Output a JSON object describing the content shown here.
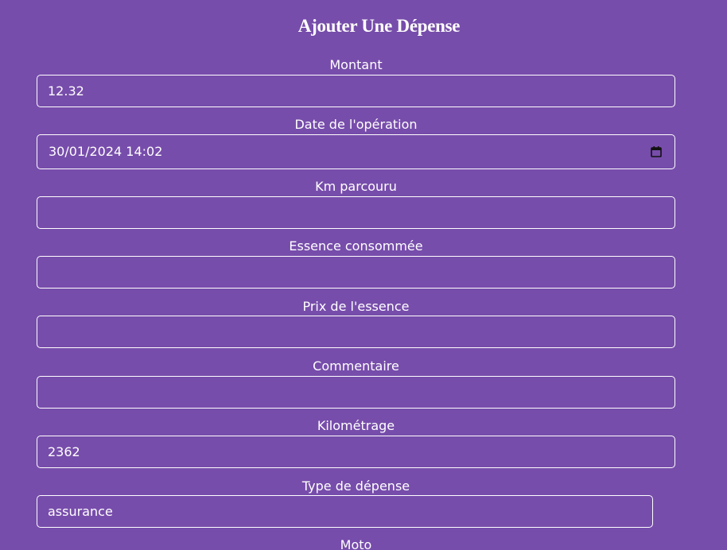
{
  "title": "Ajouter Une Dépense",
  "fields": [
    {
      "label": "Montant",
      "value": "12.32"
    },
    {
      "label": "Date de l'opération",
      "value": "30/01/2024 14:02",
      "icon": "calendar-icon"
    },
    {
      "label": "Km parcouru",
      "value": ""
    },
    {
      "label": "Essence consommée",
      "value": ""
    },
    {
      "label": "Prix de l'essence",
      "value": ""
    },
    {
      "label": "Commentaire",
      "value": ""
    },
    {
      "label": "Kilométrage",
      "value": "2362"
    },
    {
      "label": "Type de dépense",
      "value": "assurance"
    },
    {
      "label": "Moto"
    }
  ]
}
